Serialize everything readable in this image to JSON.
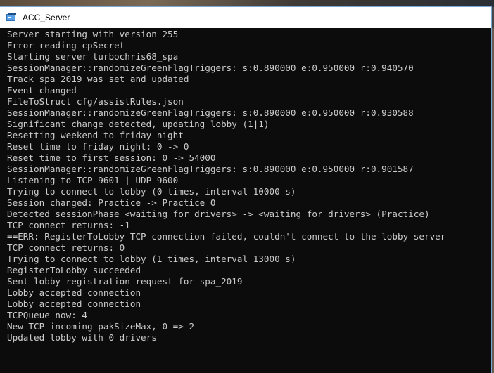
{
  "window": {
    "title": "ACC_Server"
  },
  "icons": {
    "app": "console-app-icon"
  },
  "colors": {
    "console_bg": "#0c0c0c",
    "console_text": "#cccccc",
    "titlebar_bg": "#ffffff"
  },
  "console": {
    "lines": [
      "Server starting with version 255",
      "Error reading cpSecret",
      "Starting server turbochris68_spa",
      "SessionManager::randomizeGreenFlagTriggers: s:0.890000 e:0.950000 r:0.940570",
      "Track spa_2019 was set and updated",
      "Event changed",
      "FileToStruct cfg/assistRules.json",
      "SessionManager::randomizeGreenFlagTriggers: s:0.890000 e:0.950000 r:0.930588",
      "Significant change detected, updating lobby (1|1)",
      "Resetting weekend to friday night",
      "Reset time to friday night: 0 -> 0",
      "Reset time to first session: 0 -> 54000",
      "SessionManager::randomizeGreenFlagTriggers: s:0.890000 e:0.950000 r:0.901587",
      "Listening to TCP 9601 | UDP 9600",
      "Trying to connect to lobby (0 times, interval 10000 s)",
      "Session changed: Practice -> Practice 0",
      "Detected sessionPhase <waiting for drivers> -> <waiting for drivers> (Practice)",
      "TCP connect returns: -1",
      "==ERR: RegisterToLobby TCP connection failed, couldn't connect to the lobby server",
      "TCP connect returns: 0",
      "Trying to connect to lobby (1 times, interval 13000 s)",
      "RegisterToLobby succeeded",
      "Sent lobby registration request for spa_2019",
      "Lobby accepted connection",
      "Lobby accepted connection",
      "TCPQueue now: 4",
      "New TCP incoming pakSizeMax, 0 => 2",
      "Updated lobby with 0 drivers"
    ]
  }
}
